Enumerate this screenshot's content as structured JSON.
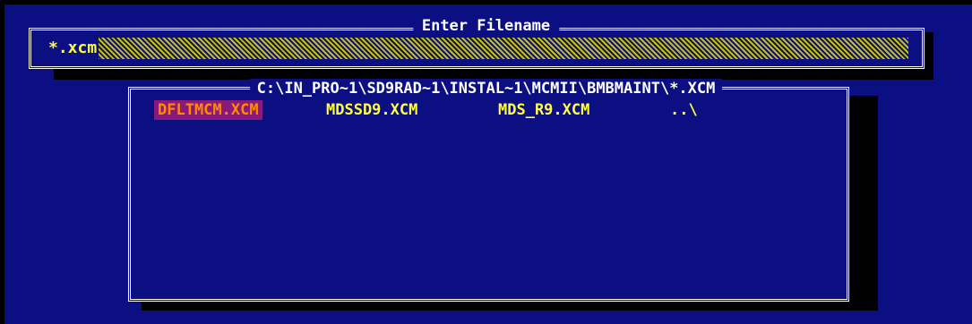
{
  "dialog": {
    "title": "Enter Filename",
    "filename_input": {
      "value": "*.xcm"
    }
  },
  "file_list": {
    "path": "C:\\IN_PRO~1\\SD9RAD~1\\INSTAL~1\\MCMII\\BMBMAINT\\*.XCM",
    "items": [
      {
        "label": "DFLTMCM.XCM",
        "selected": true
      },
      {
        "label": "MDSSD9.XCM",
        "selected": false
      },
      {
        "label": "MDS_R9.XCM",
        "selected": false
      },
      {
        "label": "..\\",
        "selected": false
      }
    ]
  },
  "colors": {
    "background": "#0b0f82",
    "text": "#ffffff",
    "file_text": "#ffff3c",
    "selection_bg": "#8a1a7a",
    "selection_text": "#ff8a00"
  }
}
